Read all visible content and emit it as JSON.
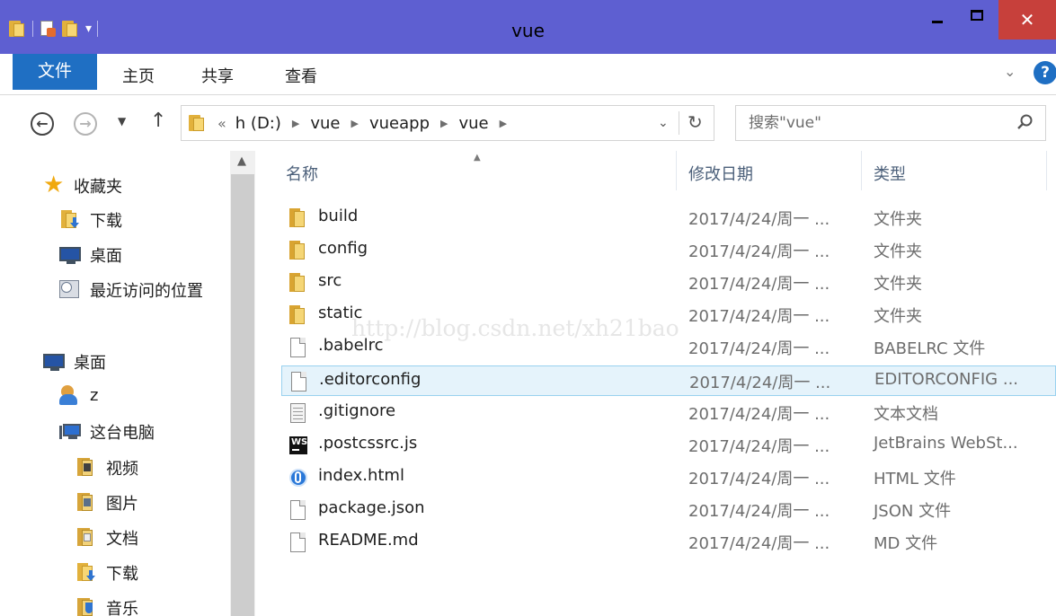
{
  "window": {
    "title": "vue",
    "close_symbol": "✕"
  },
  "ribbon": {
    "tabs": [
      "文件",
      "主页",
      "共享",
      "查看"
    ],
    "expand_symbol": "⌄",
    "help_symbol": "?"
  },
  "address": {
    "overflow": "«",
    "crumbs": [
      "h (D:)",
      "vue",
      "vueapp",
      "vue"
    ],
    "search_placeholder": "搜索\"vue\""
  },
  "navpane": {
    "items": [
      {
        "label": "收藏夹",
        "icon": "star-icon"
      },
      {
        "label": "下载",
        "icon": "downloads-icon"
      },
      {
        "label": "桌面",
        "icon": "desktop-icon"
      },
      {
        "label": "最近访问的位置",
        "icon": "recent-places-icon"
      },
      {
        "label": "桌面",
        "icon": "desktop-icon"
      },
      {
        "label": "z",
        "icon": "user-icon"
      },
      {
        "label": "这台电脑",
        "icon": "this-pc-icon"
      },
      {
        "label": "视频",
        "icon": "videos-icon"
      },
      {
        "label": "图片",
        "icon": "pictures-icon"
      },
      {
        "label": "文档",
        "icon": "documents-icon"
      },
      {
        "label": "下载",
        "icon": "downloads-icon"
      },
      {
        "label": "音乐",
        "icon": "music-icon"
      }
    ]
  },
  "columns": {
    "name": "名称",
    "date": "修改日期",
    "type": "类型"
  },
  "files": [
    {
      "name": "build",
      "date": "2017/4/24/周一 ...",
      "type": "文件夹",
      "icon": "folder-icon"
    },
    {
      "name": "config",
      "date": "2017/4/24/周一 ...",
      "type": "文件夹",
      "icon": "folder-icon"
    },
    {
      "name": "src",
      "date": "2017/4/24/周一 ...",
      "type": "文件夹",
      "icon": "folder-icon"
    },
    {
      "name": "static",
      "date": "2017/4/24/周一 ...",
      "type": "文件夹",
      "icon": "folder-icon"
    },
    {
      "name": ".babelrc",
      "date": "2017/4/24/周一 ...",
      "type": "BABELRC 文件",
      "icon": "file-icon"
    },
    {
      "name": ".editorconfig",
      "date": "2017/4/24/周一 ...",
      "type": "EDITORCONFIG ...",
      "icon": "file-icon",
      "selected": true
    },
    {
      "name": ".gitignore",
      "date": "2017/4/24/周一 ...",
      "type": "文本文档",
      "icon": "text-file-icon"
    },
    {
      "name": ".postcssrc.js",
      "date": "2017/4/24/周一 ...",
      "type": "JetBrains WebSt...",
      "icon": "webstorm-file-icon"
    },
    {
      "name": "index.html",
      "date": "2017/4/24/周一 ...",
      "type": "HTML 文件",
      "icon": "html-file-icon"
    },
    {
      "name": "package.json",
      "date": "2017/4/24/周一 ...",
      "type": "JSON 文件",
      "icon": "file-icon"
    },
    {
      "name": "README.md",
      "date": "2017/4/24/周一 ...",
      "type": "MD 文件",
      "icon": "file-icon"
    }
  ],
  "watermark": "http://blog.csdn.net/xh21bao",
  "colors": {
    "titlebar": "#5e5fd1",
    "file_tab": "#1f6fc3",
    "close_button": "#c7403b",
    "selection": "#e5f3fb"
  }
}
